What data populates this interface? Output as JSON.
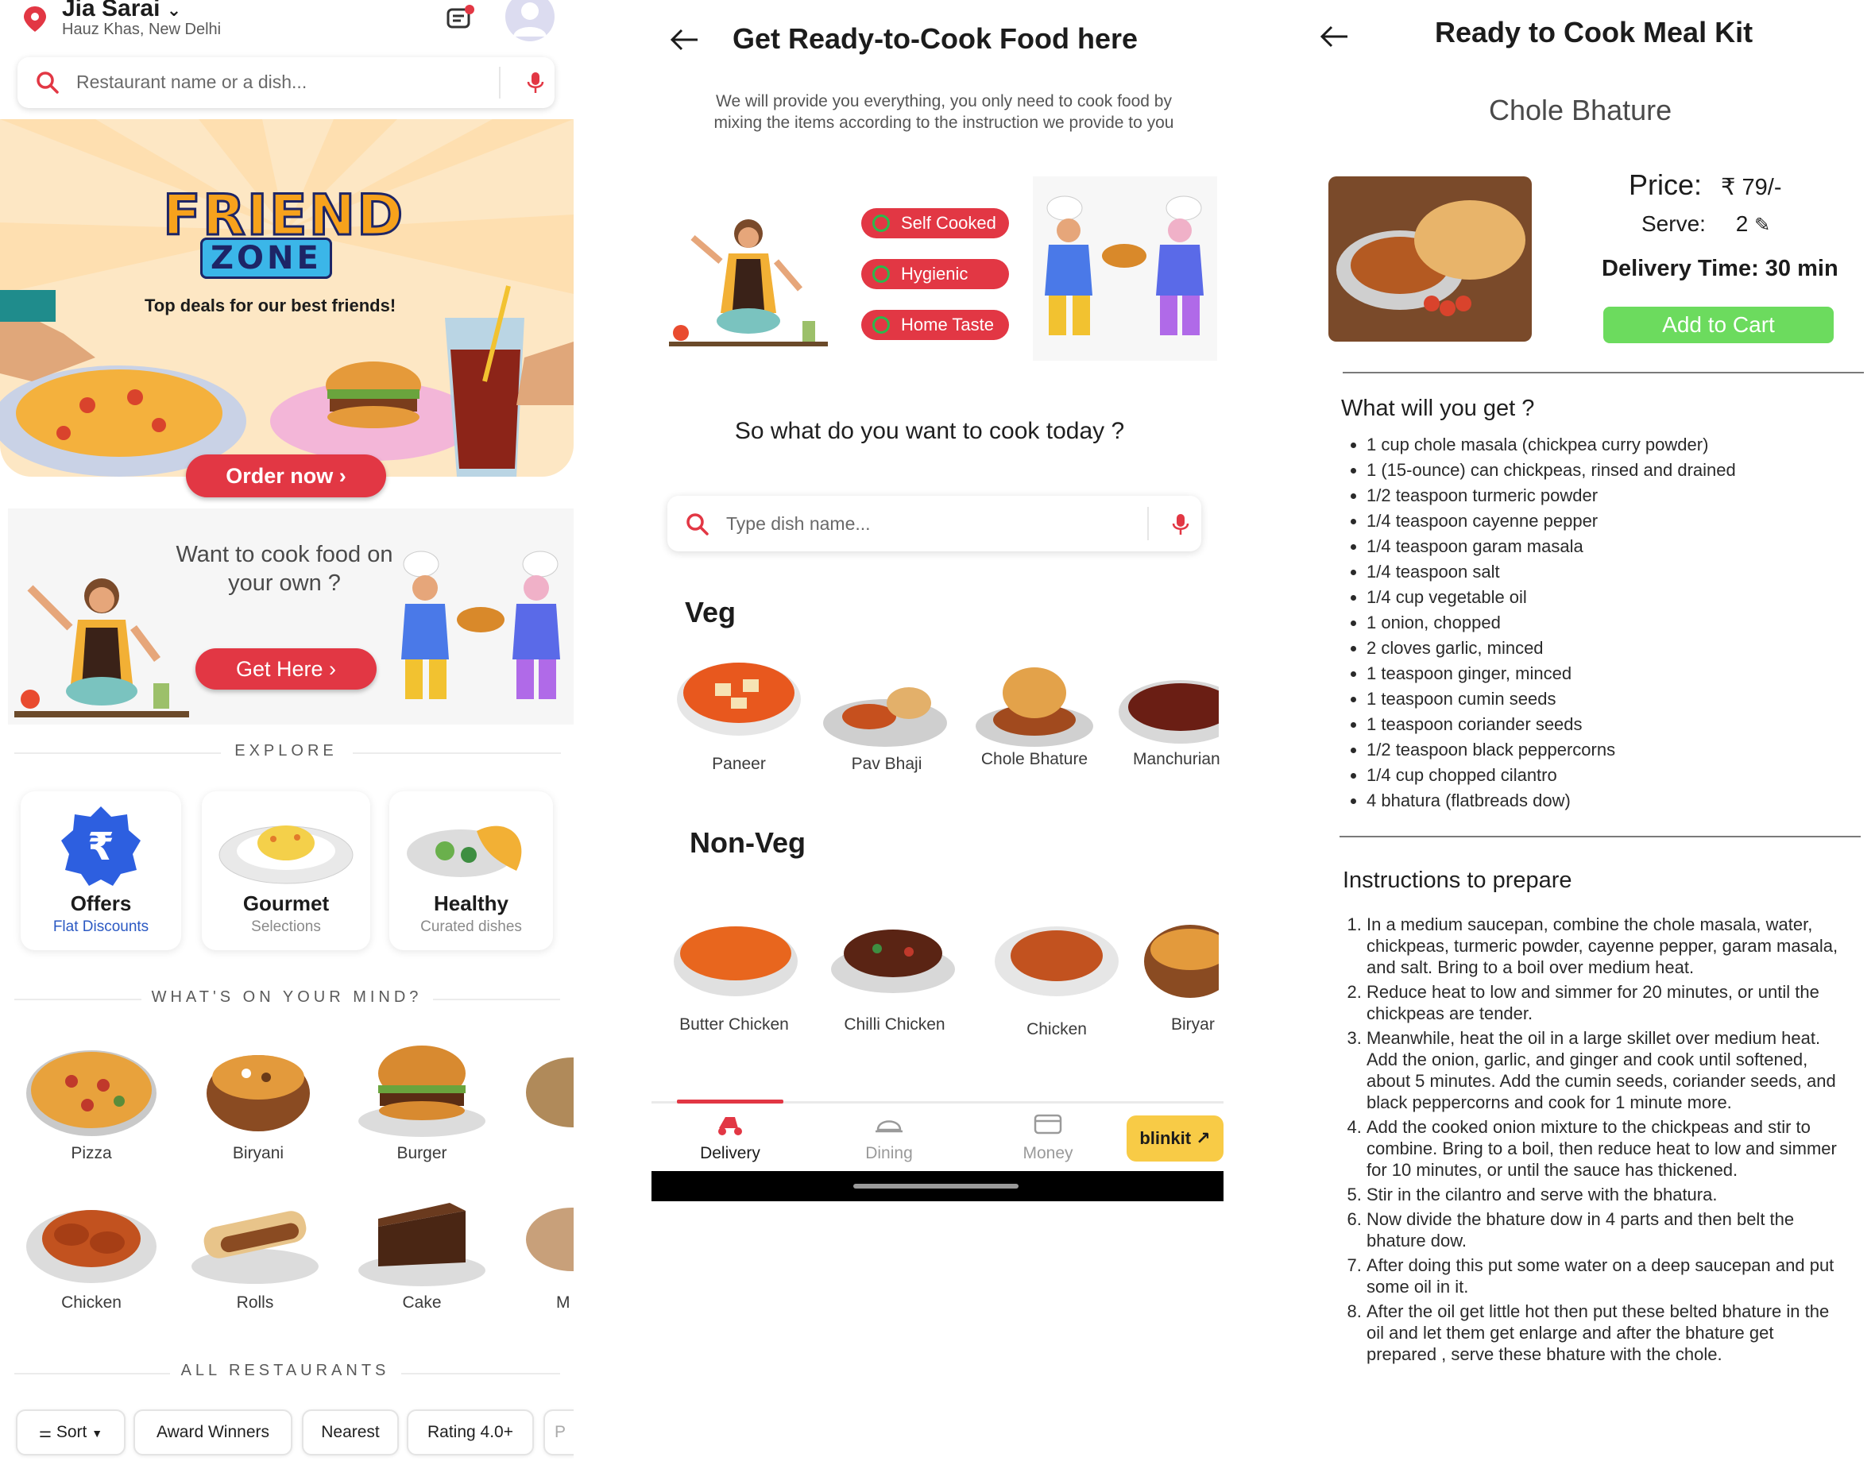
{
  "screen1": {
    "location": {
      "title": "Jia Sarai",
      "subtitle": "Hauz Khas, New Delhi"
    },
    "search": {
      "placeholder": "Restaurant name or a dish..."
    },
    "banner": {
      "title": "FRIEND",
      "zone": "ZONE",
      "tagline": "Top deals for our best friends!",
      "cta": "Order now ›"
    },
    "cook_card": {
      "question": "Want to cook food on your own ?",
      "cta": "Get Here ›"
    },
    "explore": {
      "label": "EXPLORE",
      "cards": [
        {
          "title": "Offers",
          "subtitle": "Flat Discounts",
          "subtitle_color": "#2b59c3"
        },
        {
          "title": "Gourmet",
          "subtitle": "Selections",
          "subtitle_color": "#8a8a8a"
        },
        {
          "title": "Healthy",
          "subtitle": "Curated dishes",
          "subtitle_color": "#8a8a8a"
        }
      ]
    },
    "mind": {
      "label": "WHAT'S ON YOUR MIND?",
      "row1": [
        "Pizza",
        "Biryani",
        "Burger"
      ],
      "row2": [
        "Chicken",
        "Rolls",
        "Cake",
        "M"
      ]
    },
    "restaurants": {
      "label": "ALL RESTAURANTS",
      "chips": [
        "Sort",
        "Award Winners",
        "Nearest",
        "Rating 4.0+",
        "P"
      ]
    },
    "colors": {
      "brand": "#e23744",
      "banner_bg": "#fde7c4"
    }
  },
  "screen2": {
    "title": "Get Ready-to-Cook Food here",
    "description": "We will provide you everything, you only need to cook food by mixing the items according to the instruction we provide to you",
    "badges": [
      "Self Cooked",
      "Hygienic",
      "Home Taste"
    ],
    "question": "So what do you want to cook today ?",
    "search": {
      "placeholder": "Type dish name..."
    },
    "veg": {
      "heading": "Veg",
      "items": [
        "Paneer",
        "Pav Bhaji",
        "Chole Bhature",
        "Manchurian"
      ]
    },
    "nonveg": {
      "heading": "Non-Veg",
      "items": [
        "Butter Chicken",
        "Chilli Chicken",
        "Chicken",
        "Biryar"
      ]
    },
    "nav": {
      "items": [
        "Delivery",
        "Dining",
        "Money"
      ],
      "active": "Delivery",
      "blinkit": "blinkit ↗"
    }
  },
  "screen3": {
    "title": "Ready to Cook Meal Kit",
    "dish": "Chole Bhature",
    "price_label": "Price:",
    "price_value": "₹ 79/-",
    "serve_label": "Serve:",
    "serve_value": "2",
    "delivery": "Delivery Time: 30 min",
    "cta": "Add to Cart",
    "get_heading": "What will you get ?",
    "ingredients": [
      "1 cup chole masala (chickpea curry powder)",
      "1 (15-ounce) can chickpeas, rinsed and drained",
      "1/2 teaspoon turmeric powder",
      "1/4 teaspoon cayenne pepper",
      "1/4 teaspoon garam masala",
      "1/4 teaspoon salt",
      "1/4 cup vegetable oil",
      "1 onion, chopped",
      "2 cloves garlic, minced",
      "1 teaspoon ginger, minced",
      "1 teaspoon cumin seeds",
      "1 teaspoon coriander seeds",
      "1/2 teaspoon black peppercorns",
      "1/4 cup chopped cilantro",
      "4 bhatura (flatbreads dow)"
    ],
    "instr_heading": "Instructions to prepare",
    "instructions": [
      "In a medium saucepan, combine the chole masala, water, chickpeas, turmeric powder, cayenne pepper, garam masala, and salt. Bring to a boil over medium heat.",
      "Reduce heat to low and simmer for 20 minutes, or until the chickpeas are tender.",
      "Meanwhile, heat the oil in a large skillet over medium heat. Add the onion, garlic, and ginger and cook until softened, about 5 minutes. Add the cumin seeds, coriander seeds, and black peppercorns and cook for 1 minute more.",
      "Add the cooked onion mixture to the chickpeas and stir to combine. Bring to a boil, then reduce heat to low and simmer for 10 minutes, or until the sauce has thickened.",
      "Stir in the cilantro and serve with the bhatura.",
      "Now divide the bhature dow in 4 parts and then belt the bhature dow.",
      "After doing this put some water on a deep saucepan and put some oil in it.",
      "After the oil get little hot then put these belted bhature in the oil and let them get enlarge and after the bhature get prepared , serve these bhature with the chole."
    ]
  }
}
